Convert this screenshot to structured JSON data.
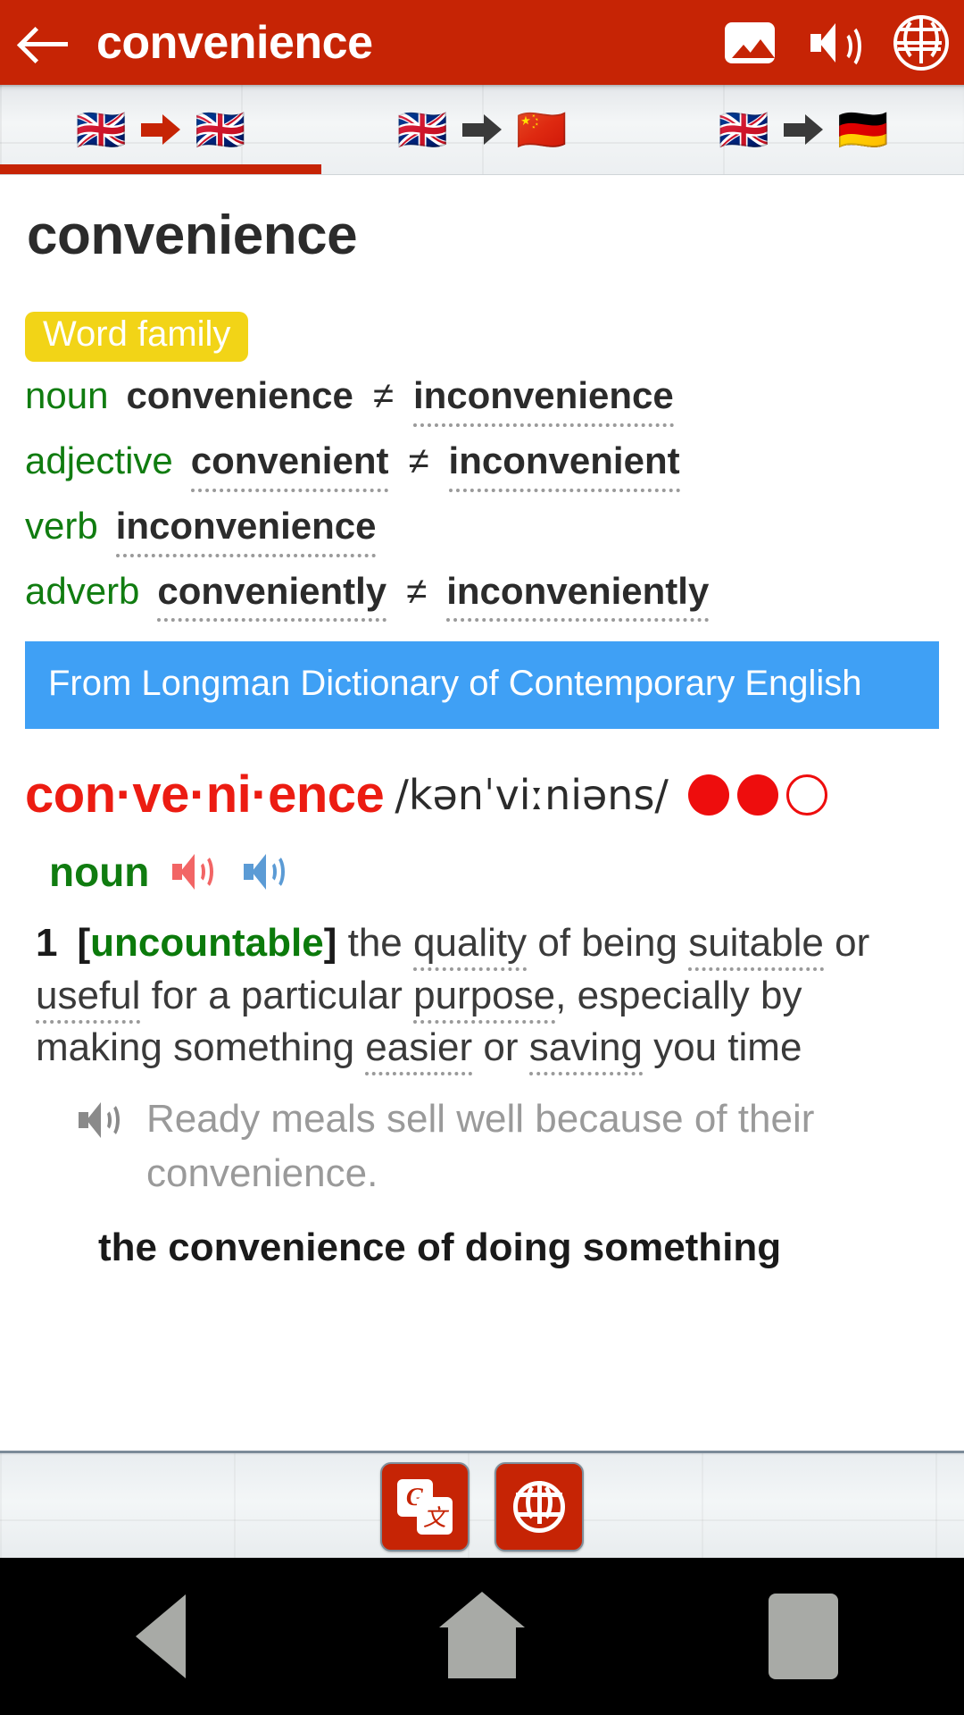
{
  "appbar": {
    "back_icon": "back-arrow-icon",
    "title": "convenience",
    "actions": [
      {
        "icon": "image-icon",
        "name": "image-button"
      },
      {
        "icon": "speaker-icon",
        "name": "sound-button"
      },
      {
        "icon": "globe-icon",
        "name": "web-button"
      }
    ],
    "background_color": "#c62405"
  },
  "tabs": [
    {
      "id": "en-en",
      "source_flag": "🇬🇧",
      "target_flag": "🇬🇧",
      "arrow_color": "#c62405",
      "active": true
    },
    {
      "id": "en-zh",
      "source_flag": "🇬🇧",
      "target_flag": "🇨🇳",
      "arrow_color": "#3a3a3a",
      "active": false
    },
    {
      "id": "en-de",
      "source_flag": "🇬🇧",
      "target_flag": "🇩🇪",
      "arrow_color": "#3a3a3a",
      "active": false
    }
  ],
  "entry": {
    "headword_plain": "convenience",
    "word_family": {
      "badge_label": "Word family",
      "badge_color": "#f2d417",
      "rows": [
        {
          "pos": "noun",
          "positive": "convenience",
          "positive_underline": false,
          "sep": "≠",
          "negative": "inconvenience",
          "negative_underline": true
        },
        {
          "pos": "adjective",
          "positive": "convenient",
          "positive_underline": true,
          "sep": "≠",
          "negative": "inconvenient",
          "negative_underline": true
        },
        {
          "pos": "verb",
          "positive": "inconvenience",
          "positive_underline": true,
          "sep": "",
          "negative": "",
          "negative_underline": false
        },
        {
          "pos": "adverb",
          "positive": "conveniently",
          "positive_underline": true,
          "sep": "≠",
          "negative": "inconveniently",
          "negative_underline": true
        }
      ]
    },
    "source_banner": {
      "text": "From Longman Dictionary of Contemporary English",
      "background_color": "#3fa0f5"
    },
    "headword_syllables": "con·ve·ni·ence",
    "headword_color": "#ec1c12",
    "ipa": "/kənˈviːniəns/",
    "frequency_dots": [
      "filled",
      "filled",
      "empty"
    ],
    "frequency_color": "#ee0d0d",
    "pos_label": "noun",
    "pos_color": "#107c10",
    "audio_buttons": [
      {
        "name": "audio-british",
        "color": "#f26565"
      },
      {
        "name": "audio-american",
        "color": "#5b9bd5"
      }
    ],
    "senses": [
      {
        "number": "1",
        "grammar_label": "uncountable",
        "grammar_color": "#0b7a0b",
        "definition_parts": [
          {
            "text": "the ",
            "underline": false
          },
          {
            "text": "quality",
            "underline": true
          },
          {
            "text": " of being ",
            "underline": false
          },
          {
            "text": "suitable",
            "underline": true
          },
          {
            "text": " or ",
            "underline": false
          },
          {
            "text": "useful",
            "underline": true
          },
          {
            "text": " for a particular ",
            "underline": false
          },
          {
            "text": "purpose",
            "underline": true
          },
          {
            "text": ", especially by making something ",
            "underline": false
          },
          {
            "text": "easier",
            "underline": true
          },
          {
            "text": " or ",
            "underline": false
          },
          {
            "text": "saving",
            "underline": true
          },
          {
            "text": " you time",
            "underline": false
          }
        ],
        "example": "Ready meals sell well because of their convenience.",
        "example_audio": "speaker-icon",
        "collocation": "the convenience of doing something"
      }
    ]
  },
  "bottom_toolbar": {
    "buttons": [
      {
        "name": "google-translate-button",
        "icon": "google-translate-icon",
        "glyph_left": "G",
        "glyph_right": "文"
      },
      {
        "name": "web-search-button",
        "icon": "globe-icon"
      }
    ],
    "button_color": "#c62405"
  },
  "navbar": {
    "buttons": [
      {
        "name": "android-back-button",
        "icon": "triangle-left-icon"
      },
      {
        "name": "android-home-button",
        "icon": "home-icon"
      },
      {
        "name": "android-recents-button",
        "icon": "square-icon"
      }
    ]
  }
}
